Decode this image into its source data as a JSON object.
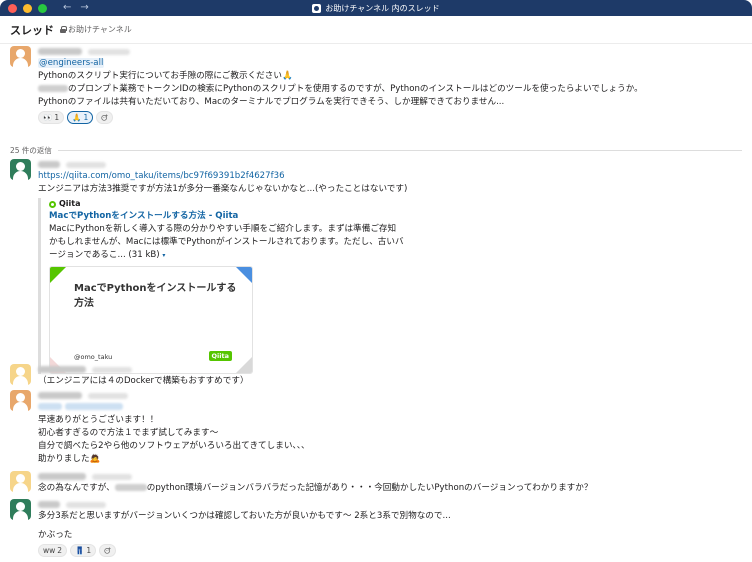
{
  "window": {
    "title": "お助けチャンネル 内のスレッド",
    "back_arrow": "←",
    "forward_arrow": "→"
  },
  "header": {
    "title": "スレッド",
    "channel": "お助けチャンネル"
  },
  "root": {
    "mention": "@engineers-all",
    "line1": "Pythonのスクリプト実行についてお手隙の際にご教示ください🙏",
    "line2": "のプロンプト業務でトークンIDの検索にPythonのスクリプトを使用するのですが、Pythonのインストールはどのツールを使ったらよいでしょうか。",
    "line3": "Pythonのファイルは共有いただいており、Macのターミナルでプログラムを実行できそう、しか理解できておりません...",
    "reactions": [
      {
        "emoji": "👀",
        "count": "1"
      },
      {
        "emoji": "🙏",
        "count": "1"
      }
    ],
    "add_reaction_icon": "add-reaction-icon"
  },
  "replies_label": "25 件の返信",
  "reply1": {
    "link": "https://qiita.com/omo_taku/items/bc97f69391b2f4627f36",
    "text": "エンジニアは方法3推奨ですが方法1が多分一番楽なんじゃないかなと...(やったことはないです)",
    "unfurl": {
      "site": "Qiita",
      "title": "MacでPythonをインストールする方法 - Qiita",
      "desc1": "MacにPythonを新しく導入する際の分かりやすい手順をご紹介します。まずは準備ご存知",
      "desc2": "かもしれませんが、Macには標準でPythonがインストールされております。ただし、古いバ",
      "desc3": "ージョンであるこ... (31 kB)",
      "caret": "▾",
      "thumb_title": "MacでPythonをインストールする方法",
      "thumb_author": "@omo_taku",
      "thumb_logo": "Qiita"
    }
  },
  "reply2": {
    "text": "（エンジニアには４のDockerで構築もおすすめです）"
  },
  "reply3": {
    "line1": "早速ありがとうございます！！",
    "line2": "初心者すぎるので方法１でまず試してみます〜",
    "line3": "自分で調べたら2やら他のソフトウェアがいろいろ出てきてしまい、、、",
    "line4": "助かりました🙇"
  },
  "reply4": {
    "text_before": "念の為なんですが、",
    "text_after": "のpython環境バージョンバラバラだった記憶があり・・・今回動かしたいPythonのバージョンってわかりますか？"
  },
  "reply5": {
    "line1": "多分3系だと思いますがバージョンいくつかは確認しておいた方が良いかもです〜 2系と3系で別物なので...",
    "line2": "かぶった",
    "reactions": [
      {
        "emoji": "ww",
        "count": "2"
      },
      {
        "emoji": "👖",
        "count": "1"
      }
    ]
  },
  "colors": {
    "titlebar": "#1e3a68",
    "link": "#1264a3",
    "qiita_green": "#55c500"
  }
}
